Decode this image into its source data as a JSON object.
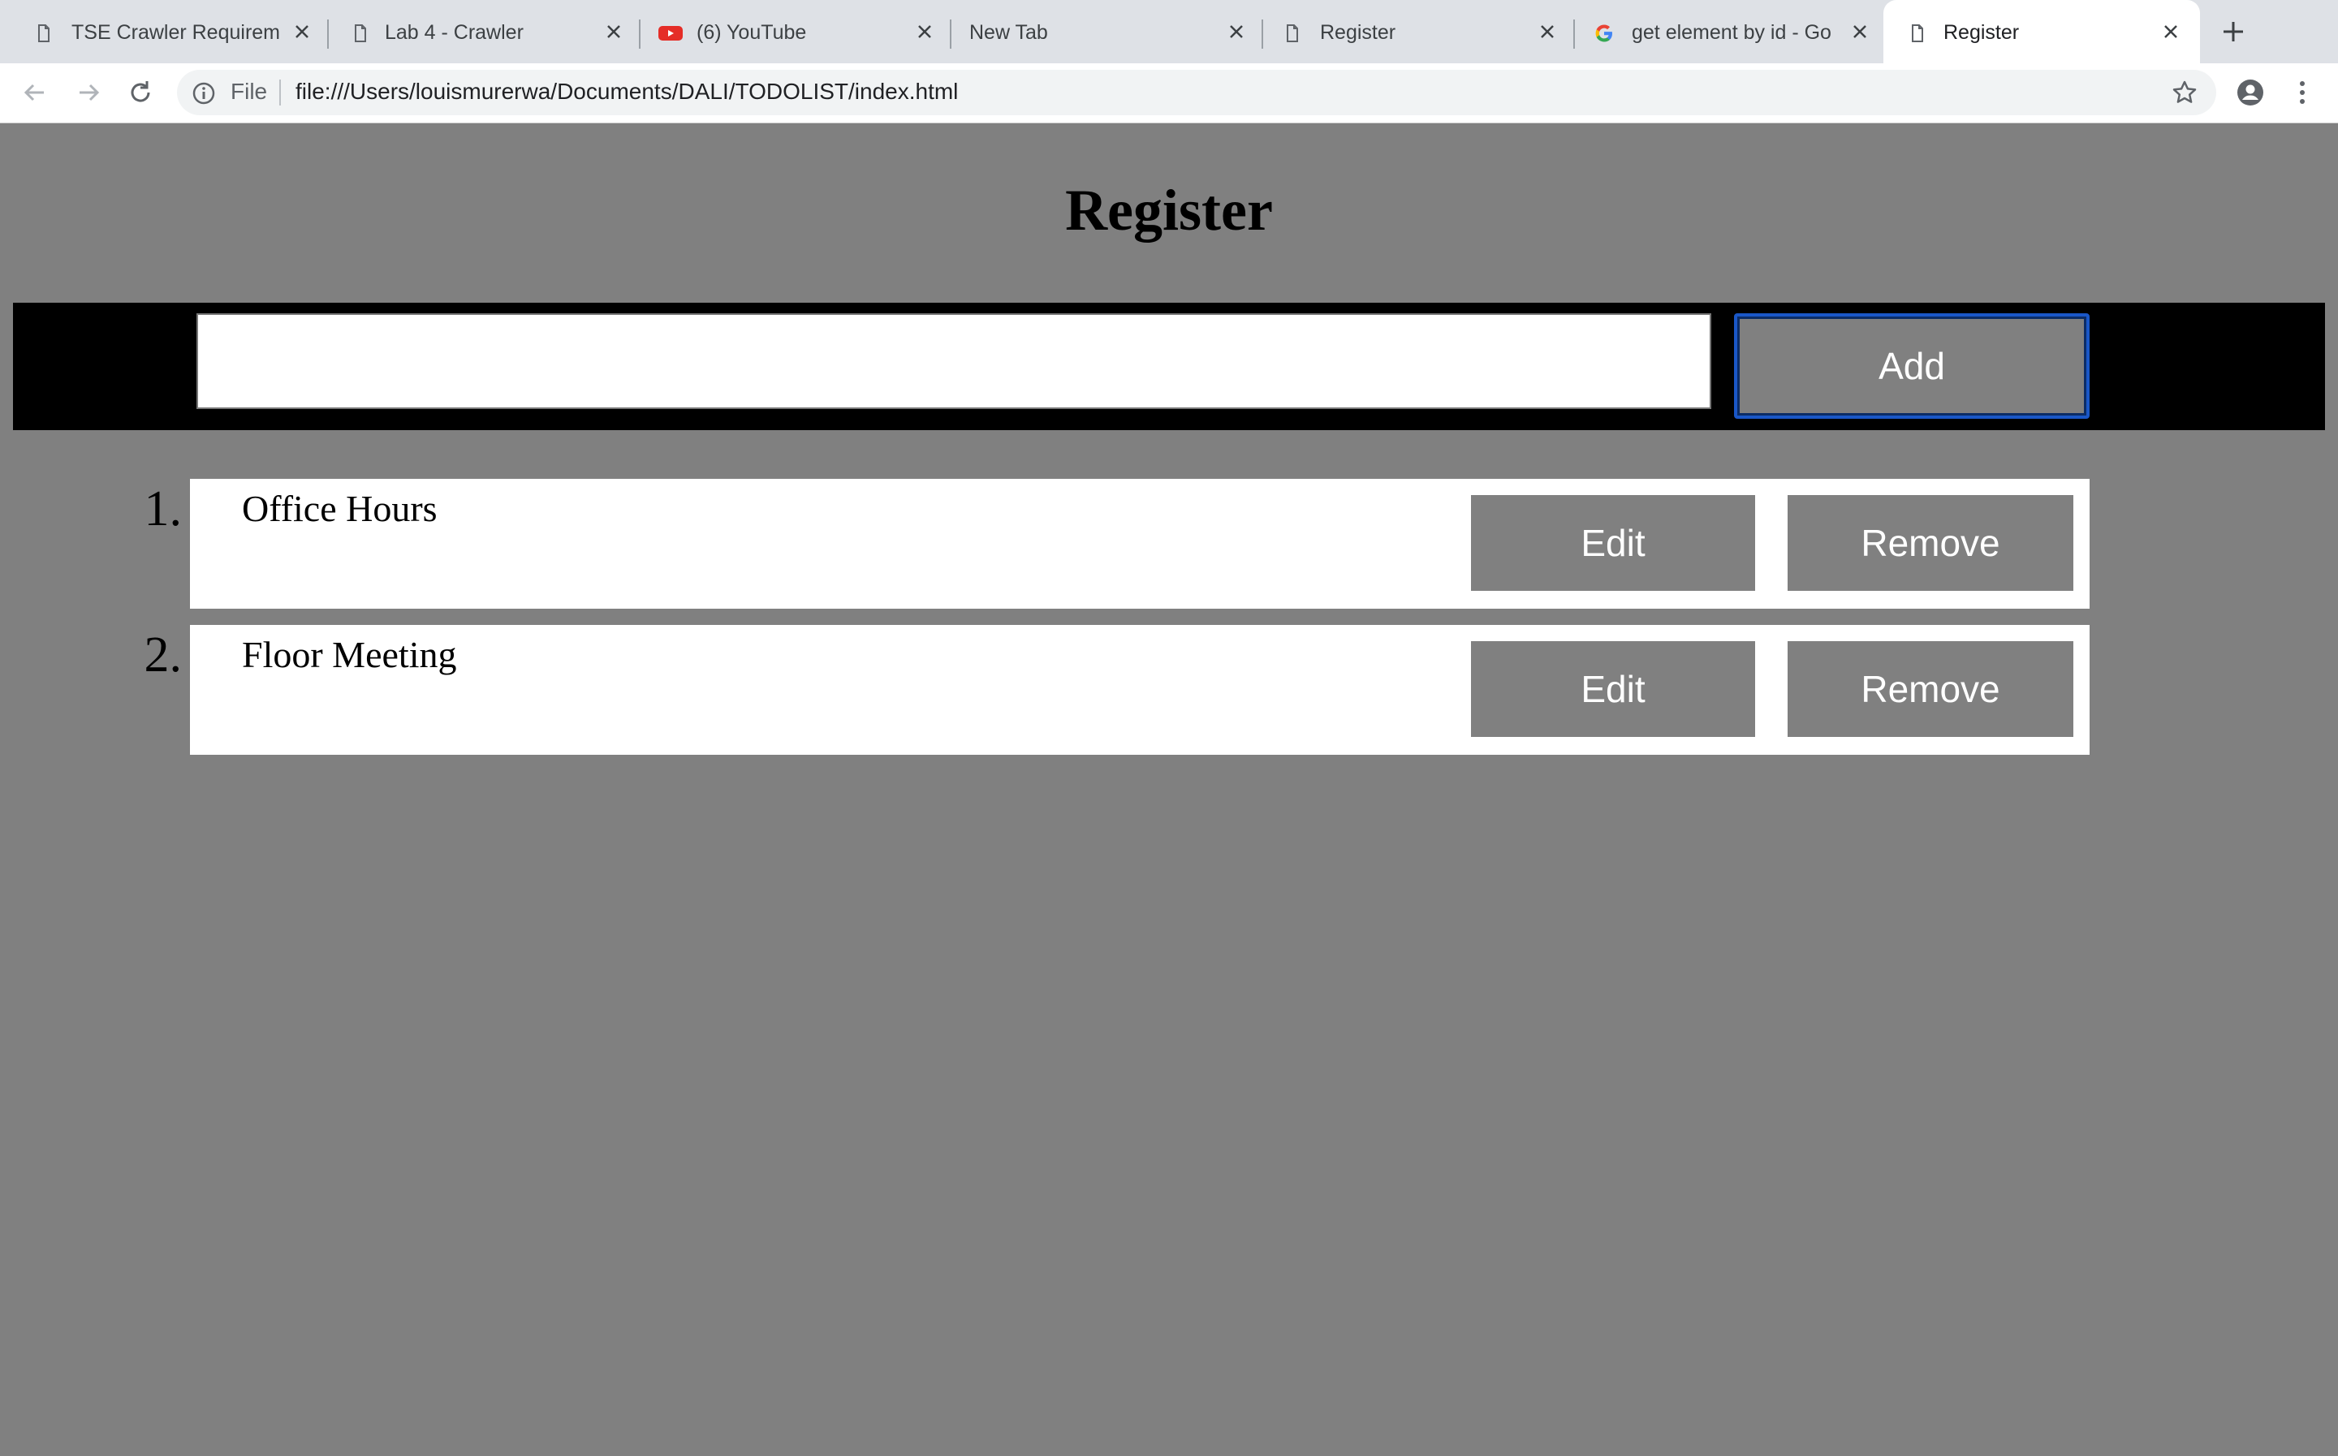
{
  "browser": {
    "tabs": [
      {
        "title": "TSE Crawler Requireme",
        "icon": "document-icon"
      },
      {
        "title": "Lab 4 - Crawler",
        "icon": "document-icon"
      },
      {
        "title": "(6) YouTube",
        "icon": "youtube-icon"
      },
      {
        "title": "New Tab",
        "icon": ""
      },
      {
        "title": "Register",
        "icon": "document-icon"
      },
      {
        "title": "get element by id - Go",
        "icon": "google-icon"
      },
      {
        "title": "Register",
        "icon": "document-icon",
        "active": true
      }
    ],
    "omnibox": {
      "scheme_label": "File",
      "url": "file:///Users/louismurerwa/Documents/DALI/TODOLIST/index.html"
    }
  },
  "page": {
    "heading": "Register",
    "input": {
      "value": "",
      "placeholder": ""
    },
    "add_label": "Add",
    "items": [
      {
        "number": "1.",
        "text": "Office Hours",
        "edit_label": "Edit",
        "remove_label": "Remove"
      },
      {
        "number": "2.",
        "text": "Floor Meeting",
        "edit_label": "Edit",
        "remove_label": "Remove"
      }
    ]
  },
  "colors": {
    "page_background": "#808080",
    "entry_bar": "#000000",
    "button_focus_ring": "#1a57c7"
  }
}
